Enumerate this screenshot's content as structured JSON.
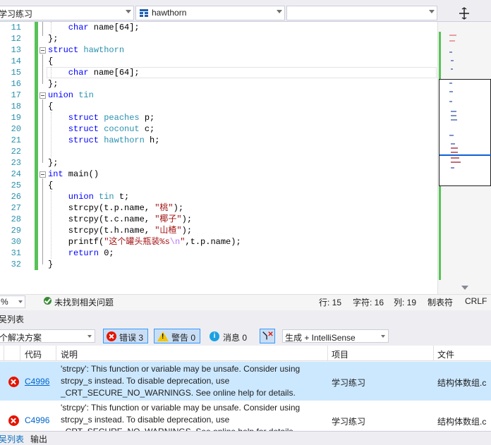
{
  "navbar": {
    "project_dropdown": "学习练习",
    "scope_dropdown": "hawthorn",
    "member_dropdown": ""
  },
  "editor": {
    "line_numbers": [
      "11",
      "12",
      "13",
      "14",
      "15",
      "16",
      "17",
      "18",
      "19",
      "20",
      "21",
      "22",
      "23",
      "24",
      "25",
      "26",
      "27",
      "28",
      "29",
      "30",
      "31",
      "32"
    ],
    "lines": {
      "l11": "    char name[64];",
      "l12": "};",
      "l13": "struct hawthorn",
      "l14": "{",
      "l15": "    char name[64];",
      "l16": "};",
      "l17": "union tin",
      "l18": "{",
      "l19": "    struct peaches p;",
      "l20": "    struct coconut c;",
      "l21": "    struct hawthorn h;",
      "l22": "",
      "l23": "};",
      "l24": "int main()",
      "l25": "{",
      "l26": "    union tin t;",
      "l27": "    strcpy(t.p.name, \"桃\");",
      "l28": "    strcpy(t.c.name, \"椰子\");",
      "l29": "    strcpy(t.h.name, \"山楂\");",
      "l30": "    printf(\"这个罐头瓶装%s\\n\",t.p.name);",
      "l31": "    return 0;",
      "l32": "}"
    }
  },
  "status": {
    "zoom": "%",
    "issues": "未找到相关问题",
    "line": "行: 15",
    "char": "字符: 16",
    "col": "列: 19",
    "tabs": "制表符",
    "eol": "CRLF"
  },
  "error_list": {
    "title": "吴列表",
    "scope": "个解决方案",
    "errors_btn": "错误 3",
    "warnings_btn": "警告 0",
    "messages_btn": "消息 0",
    "build_filter": "生成 + IntelliSense",
    "columns": {
      "code": "代码",
      "description": "说明",
      "project": "项目",
      "file": "文件"
    },
    "rows": [
      {
        "code": "C4996",
        "description": "'strcpy': This function or variable may be unsafe. Consider using strcpy_s instead. To disable deprecation, use _CRT_SECURE_NO_WARNINGS. See online help for details.",
        "project": "学习练习",
        "file": "结构体数组.c"
      },
      {
        "code": "C4996",
        "description": "'strcpy': This function or variable may be unsafe. Consider using strcpy_s instead. To disable deprecation, use _CRT_SECURE_NO_WARNINGS. See online help for details.",
        "project": "学习练习",
        "file": "结构体数组.c"
      }
    ]
  },
  "bottom_tabs": {
    "errors": "吴列表",
    "output": "输出"
  },
  "colors": {
    "keyword": "#0000ff",
    "type": "#2b91af",
    "string": "#a31515",
    "change_bar": "#57c258",
    "selection": "#cce8ff",
    "error": "#e51400"
  }
}
